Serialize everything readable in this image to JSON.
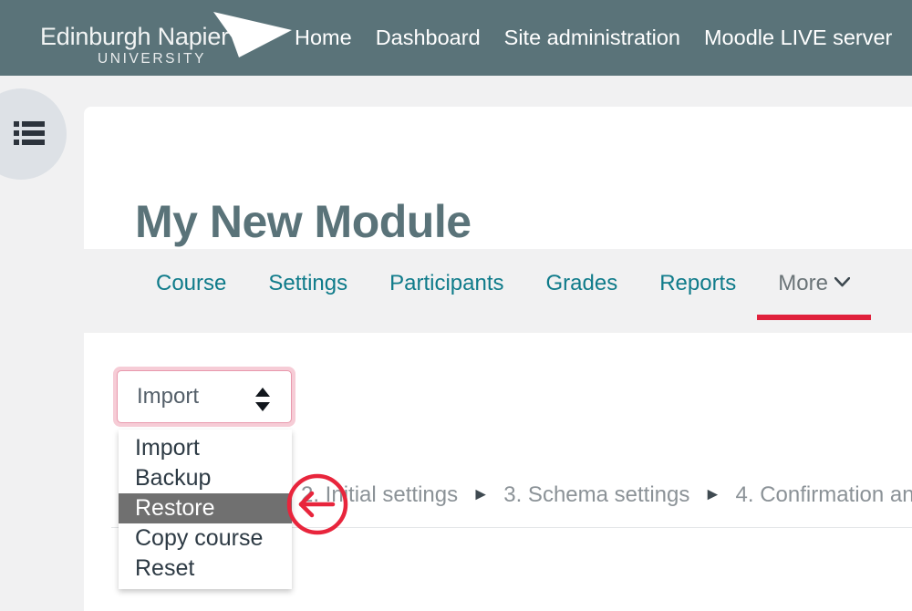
{
  "navbar": {
    "brand": {
      "name": "Edinburgh Napier",
      "subtitle": "UNIVERSITY",
      "logo_icon": "triangle-logo-icon"
    },
    "links": [
      {
        "label": "Home"
      },
      {
        "label": "Dashboard"
      },
      {
        "label": "Site administration"
      },
      {
        "label": "Moodle LIVE server"
      }
    ],
    "background_color": "#5a7379"
  },
  "drawer": {
    "toggle_icon": "list-menu-icon",
    "background_color": "#dde1e6"
  },
  "header": {
    "title": "My New Module",
    "title_color": "#5a7379"
  },
  "tabs": {
    "items": [
      {
        "label": "Course",
        "active": false
      },
      {
        "label": "Settings",
        "active": false
      },
      {
        "label": "Participants",
        "active": false
      },
      {
        "label": "Grades",
        "active": false
      },
      {
        "label": "Reports",
        "active": false
      },
      {
        "label": "More",
        "active": true
      }
    ],
    "link_color": "#0f7b8a",
    "active_underline_color": "#e0213c",
    "chevron_glyph": "⌄"
  },
  "action_select": {
    "value": "Import",
    "focus_ring_color": "#f6ccd6",
    "indicator_icon": "up-down-chevron-icon",
    "options": [
      {
        "label": "Import",
        "highlighted": false
      },
      {
        "label": "Backup",
        "highlighted": false
      },
      {
        "label": "Restore",
        "highlighted": true
      },
      {
        "label": "Copy course",
        "highlighted": false
      },
      {
        "label": "Reset",
        "highlighted": false
      }
    ],
    "highlight_color": "#707070"
  },
  "steps": {
    "separator": "►",
    "items": [
      {
        "label": "2. Initial settings"
      },
      {
        "label": "3. Schema settings"
      },
      {
        "label": "4. Confirmation an"
      }
    ],
    "text_color": "#8b9297"
  },
  "annotation": {
    "icon": "left-arrow-circle-icon",
    "color": "#e8253c"
  }
}
